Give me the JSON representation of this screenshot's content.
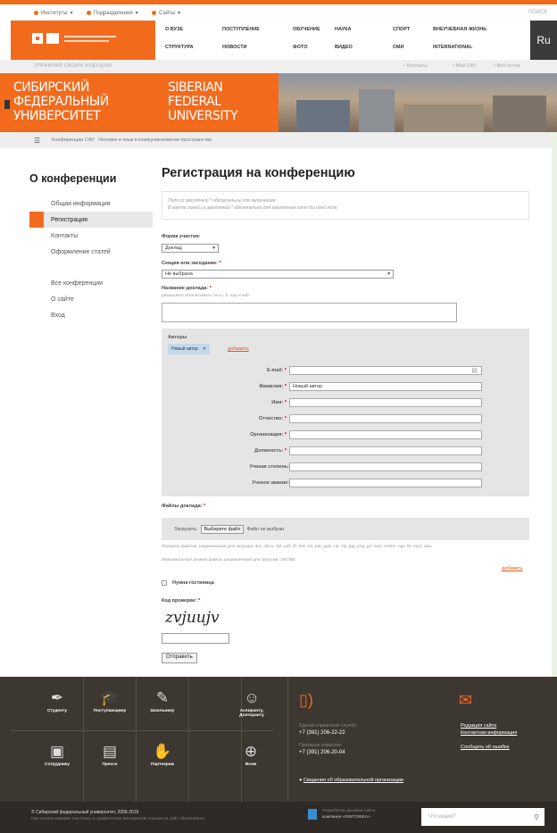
{
  "topnav": {
    "items": [
      "Институты",
      "Подразделения",
      "Сайты"
    ],
    "search_label": "ПОИСК"
  },
  "logo_text": "СИБИРСКИЙ ФЕДЕРАЛЬНЫЙ УНИВЕРСИТЕТ SIBERIAN FEDERAL UNIVERSITY",
  "menu": {
    "row1": [
      "О ВУЗЕ",
      "ПОСТУПЛЕНИЕ",
      "ОБУЧЕНИЕ",
      "НАУКА",
      "СПОРТ",
      "ВНЕУЧЕБНАЯ ЖИЗНЬ"
    ],
    "row2": [
      "СТРУКТУРА",
      "НОВОСТИ",
      "ФОТО",
      "ВИДЕО",
      "СМИ",
      "INTERNATIONAL"
    ],
    "lang": "Ru"
  },
  "subbar": {
    "left": "УПРАВЛЯЙ СВОИМ БУДУЩИМ",
    "links": [
      "Контакты",
      "Мой СФУ",
      "Веб-почта"
    ]
  },
  "banner": {
    "rus": [
      "СИБИРСКИЙ",
      "ФЕДЕРАЛЬНЫЙ",
      "УНИВЕРСИТЕТ"
    ],
    "eng": [
      "SIBERIAN",
      "FEDERAL",
      "UNIVERSITY"
    ]
  },
  "breadcrumb": {
    "items": [
      "Конференции СФУ",
      "Человек и язык в коммуникативном пространстве"
    ]
  },
  "sidebar": {
    "title": "О конференции",
    "items": [
      {
        "label": "Общая информация",
        "active": false
      },
      {
        "label": "Регистрация",
        "active": true
      },
      {
        "label": "Контакты",
        "active": false
      },
      {
        "label": "Оформление статей",
        "active": false
      }
    ],
    "items2": [
      {
        "label": "Все конференции"
      },
      {
        "label": "О сайте"
      },
      {
        "label": "Вход"
      }
    ]
  },
  "main": {
    "title": "Регистрация на конференцию",
    "note1": "Поля со звёздочкой * обязательны для заполнения.",
    "note2": "В группе полей со звёздочкой * обязательно для заполнения хотя бы одно поле.",
    "form_label": "Форма участия:",
    "form_value": "Доклад",
    "section_label": "Секция или заседание:",
    "section_value": "Не выбрана",
    "report_label": "Название доклада:",
    "report_hint": "разрешено использовать теги i, b, sup и sub",
    "authors_label": "Авторы",
    "author_tag": "Новый автор",
    "add_label": "добавить",
    "fields": [
      {
        "label": "E-mail:",
        "value": ""
      },
      {
        "label": "Фамилия:",
        "value": "Новый автор"
      },
      {
        "label": "Имя:",
        "value": ""
      },
      {
        "label": "Отчество:",
        "value": ""
      },
      {
        "label": "Организация:",
        "value": ""
      },
      {
        "label": "Должность:",
        "value": ""
      },
      {
        "label": "Ученая степень:",
        "value": ""
      },
      {
        "label": "Ученое звание:",
        "value": ""
      }
    ],
    "files_label": "Файлы доклада:",
    "upload_label": "Загрузить:",
    "choose_file": "Выберите файл",
    "no_file": "Файл не выбран",
    "formats_hint": "Форматы файлов, разрешенные для загрузки: doc, docx, dot, pdf, rtf, htm, txt, ppt, pptx, rar, zip, jpg, png, gif, mp4, webm, ogv, flv, mp3, wav.",
    "maxsize_hint": "Максимальный размер файла, разрешенный для загрузки: 200 МБ.",
    "add_files": "добавить",
    "hotel_label": "Нужна гостиница",
    "captcha_label": "Код проверки:",
    "captcha_text": "zvjuujv",
    "submit_label": "Отправить"
  },
  "footer": {
    "row1": [
      {
        "label": "Студенту",
        "icon": "pen-icon"
      },
      {
        "label": "Поступающему",
        "icon": "graduation-cap-icon"
      },
      {
        "label": "Школьнику",
        "icon": "pencil-icon"
      },
      {
        "label": "Аспиранту, Докторанту",
        "icon": "head-icon"
      }
    ],
    "row2": [
      {
        "label": "Сотруднику",
        "icon": "briefcase-icon"
      },
      {
        "label": "Прессе",
        "icon": "newspaper-icon"
      },
      {
        "label": "Партнерам",
        "icon": "handshake-icon"
      },
      {
        "label": "Всем",
        "icon": "globe-icon"
      }
    ],
    "help_label": "Единая справочная служба",
    "help_phone": "+7 (391) 206-22-22",
    "admission_label": "Приёмная комиссия",
    "admission_phone": "+7 (391) 206-20-04",
    "edit_site": "Редакция сайта",
    "contacts": "Контактная информация",
    "report_error": "Сообщить об ошибке",
    "org_info": "Сведения об образовательной организации"
  },
  "bottom": {
    "copyright": "© Сибирский федеральный университет, 2006-2016",
    "copy_note": "При использовании текстовых и графических материалов ссылка на сайт обязательна",
    "dev": "Разработка дизайна сайта",
    "dev2": "компания «SINTONIKA»",
    "search_placeholder": "Что ищем?"
  }
}
